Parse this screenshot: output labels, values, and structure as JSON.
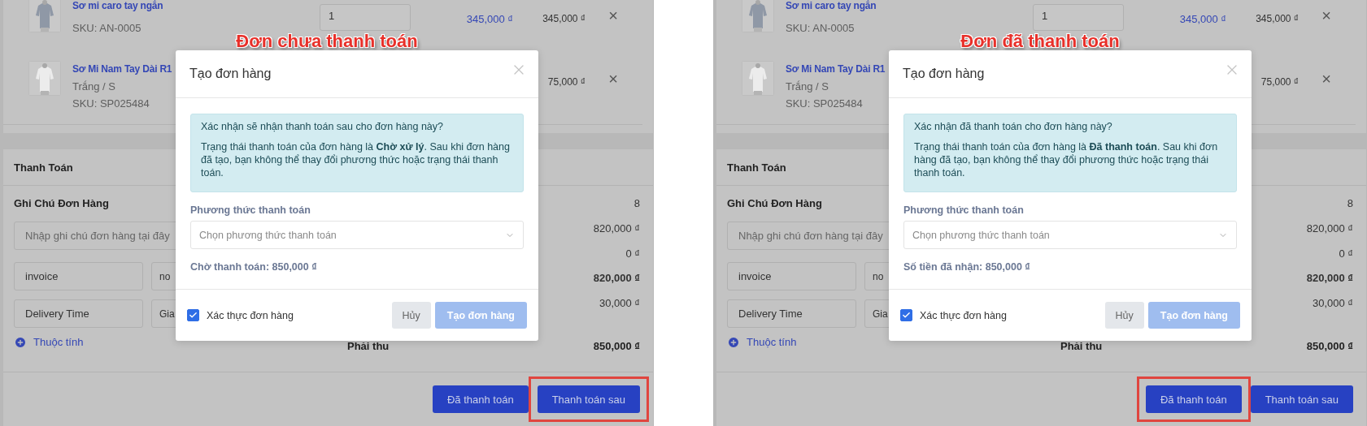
{
  "panels": [
    {
      "annotation": "Đơn chưa thanh toán",
      "products": [
        {
          "name": "Sơ mi caro tay ngắn",
          "sku": "SKU: AN-0005",
          "quantity": "1",
          "price": "345,000 ₫",
          "total": "345,000 ₫",
          "remove": "×"
        },
        {
          "name": "Sơ Mi Nam Tay Dài R1",
          "variant": "Trắng / S",
          "sku": "SKU: SP025484",
          "total": "75,000 ₫",
          "remove": "×"
        }
      ],
      "payment": {
        "title": "Thanh Toán",
        "note_label": "Ghi Chú Đơn Hàng",
        "note_placeholder": "Nhập ghi chú đơn hàng tại đây",
        "attributes": [
          {
            "key": "invoice",
            "value": "no"
          },
          {
            "key": "Delivery Time",
            "value": "Gia"
          }
        ],
        "add_attribute": "Thuộc tính",
        "summary": [
          {
            "value": "8",
            "emphasis": false
          },
          {
            "value": "820,000 ₫",
            "emphasis": false
          },
          {
            "value": "0 ₫",
            "emphasis": false
          },
          {
            "value": "820,000 ₫",
            "emphasis": true
          },
          {
            "value": "30,000 ₫",
            "emphasis": false
          }
        ],
        "total_label": "Phải thu",
        "total_value": "850,000 ₫"
      },
      "footer_buttons": [
        {
          "label": "Đã thanh toán",
          "highlighted": false
        },
        {
          "label": "Thanh toán sau",
          "highlighted": true
        }
      ],
      "modal": {
        "title": "Tạo đơn hàng",
        "question": "Xác nhận sẽ nhận thanh toán sau cho đơn hàng này?",
        "detail": "Trạng thái thanh toán của đơn hàng là **Chờ xử lý**. Sau khi đơn hàng đã tạo, bạn không thể thay đổi phương thức hoặc trạng thái thanh toán.",
        "field_label": "Phương thức thanh toán",
        "select_placeholder": "Chọn phương thức thanh toán",
        "amount": "Chờ thanh toán: 850,000 ₫",
        "checkbox": {
          "label": "Xác thực đơn hàng",
          "checked": true
        },
        "cancel": "Hủy",
        "confirm": {
          "label": "Tạo đơn hàng",
          "disabled": true
        }
      }
    },
    {
      "annotation": "Đơn đã thanh toán",
      "products": [
        {
          "name": "Sơ mi caro tay ngắn",
          "sku": "SKU: AN-0005",
          "quantity": "1",
          "price": "345,000 ₫",
          "total": "345,000 ₫",
          "remove": "×"
        },
        {
          "name": "Sơ Mi Nam Tay Dài R1",
          "variant": "Trắng / S",
          "sku": "SKU: SP025484",
          "total": "75,000 ₫",
          "remove": "×"
        }
      ],
      "payment": {
        "title": "Thanh Toán",
        "note_label": "Ghi Chú Đơn Hàng",
        "note_placeholder": "Nhập ghi chú đơn hàng tại đây",
        "attributes": [
          {
            "key": "invoice",
            "value": "no"
          },
          {
            "key": "Delivery Time",
            "value": "Gia"
          }
        ],
        "add_attribute": "Thuộc tính",
        "summary": [
          {
            "value": "8",
            "emphasis": false
          },
          {
            "value": "820,000 ₫",
            "emphasis": false
          },
          {
            "value": "0 ₫",
            "emphasis": false
          },
          {
            "value": "820,000 ₫",
            "emphasis": true
          },
          {
            "value": "30,000 ₫",
            "emphasis": false
          }
        ],
        "total_label": "Phải thu",
        "total_value": "850,000 ₫"
      },
      "footer_buttons": [
        {
          "label": "Đã thanh toán",
          "highlighted": true
        },
        {
          "label": "Thanh toán sau",
          "highlighted": false
        }
      ],
      "modal": {
        "title": "Tạo đơn hàng",
        "question": "Xác nhận đã thanh toán cho đơn hàng này?",
        "detail": "Trạng thái thanh toán của đơn hàng là **Đã thanh toán**. Sau khi đơn hàng đã tạo, bạn không thể thay đổi phương thức hoặc trạng thái thanh toán.",
        "field_label": "Phương thức thanh toán",
        "select_placeholder": "Chọn phương thức thanh toán",
        "amount": "Số tiền đã nhận: 850,000 ₫",
        "checkbox": {
          "label": "Xác thực đơn hàng",
          "checked": true
        },
        "cancel": "Hủy",
        "confirm": {
          "label": "Tạo đơn hàng",
          "disabled": true
        }
      }
    }
  ]
}
